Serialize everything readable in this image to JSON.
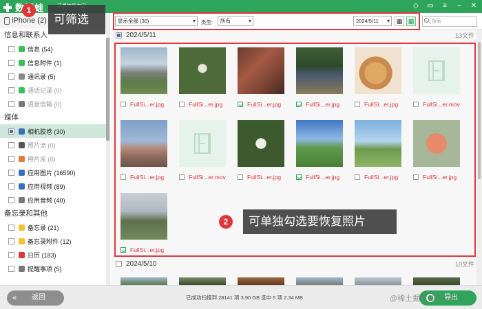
{
  "titlebar": {
    "app_name": "数据蛙",
    "subtitle": "苹果恢复专家"
  },
  "sidebar": {
    "device": "iPhone (2)",
    "sections": [
      {
        "title": "信息和联系人",
        "items": [
          {
            "label": "信息 (54)",
            "color": "#3cbf5a",
            "dim": false
          },
          {
            "label": "信息附件 (1)",
            "color": "#3cbf5a",
            "dim": false
          },
          {
            "label": "通讯录 (5)",
            "color": "#8a8a8a",
            "dim": false
          },
          {
            "label": "通话记录 (0)",
            "color": "#3cbf5a",
            "dim": true
          },
          {
            "label": "语音信箱 (0)",
            "color": "#777777",
            "dim": true
          }
        ]
      },
      {
        "title": "媒体",
        "items": [
          {
            "label": "相机胶卷 (30)",
            "color": "#3b6fb5",
            "dim": false,
            "active": true
          },
          {
            "label": "照片流 (0)",
            "color": "#555555",
            "dim": true
          },
          {
            "label": "照片库 (0)",
            "color": "#e07b39",
            "dim": true
          },
          {
            "label": "应用图片 (16590)",
            "color": "#3b6fb5",
            "dim": false
          },
          {
            "label": "应用视频 (89)",
            "color": "#3b6fb5",
            "dim": false
          },
          {
            "label": "应用音频 (40)",
            "color": "#777777",
            "dim": false
          }
        ]
      },
      {
        "title": "备忘录和其他",
        "items": [
          {
            "label": "备忘录 (21)",
            "color": "#f2c230",
            "dim": false
          },
          {
            "label": "备忘录附件 (12)",
            "color": "#f2c230",
            "dim": false
          },
          {
            "label": "日历 (183)",
            "color": "#e0373b",
            "dim": false
          },
          {
            "label": "提醒事项 (5)",
            "color": "#777777",
            "dim": false
          }
        ]
      }
    ]
  },
  "toolbar": {
    "filter_select": "显示全部 (30)",
    "type_label": "类型:",
    "type_select": "所有",
    "date_select": "2024/5/11",
    "search_placeholder": "搜索"
  },
  "groups": [
    {
      "date": "2024/5/11",
      "count": "13文件"
    },
    {
      "date": "2024/5/10",
      "count": "10文件"
    }
  ],
  "files": [
    {
      "name": "FullSi...er.jpg",
      "checked": false,
      "kind": "photo",
      "bg": "linear-gradient(180deg,#9fb6cc 0%,#c7d3de 35%,#7a7f78 55%,#5d7a48 75%,#6e8d52 100%)"
    },
    {
      "name": "FullSi...er.jpg",
      "checked": false,
      "kind": "photo",
      "bg": "radial-gradient(circle at 50% 45%,#e8e6d8 0 12%,#4d6b3a 14% 100%)"
    },
    {
      "name": "FullSi...er.jpg",
      "checked": true,
      "kind": "photo",
      "bg": "linear-gradient(135deg,#6b3b2f 0%,#a35a44 40%,#7c4333 70%,#3f2a22 100%)"
    },
    {
      "name": "FullSi...er.jpg",
      "checked": true,
      "kind": "photo",
      "bg": "linear-gradient(180deg,#3e5f36 0%,#2f4a2a 40%,#4a5a6e 60%,#8a7a5a 100%)"
    },
    {
      "name": "FullSi...er.jpg",
      "checked": false,
      "kind": "photo",
      "bg": "radial-gradient(circle at 45% 55%,#e0a865 0 30%,#c98a4b 31% 45%,#efe2cf 46% 100%)"
    },
    {
      "name": "FullSi...er.mov",
      "checked": false,
      "kind": "video",
      "bg": ""
    },
    {
      "name": "FullSi...er.jpg",
      "checked": false,
      "kind": "photo",
      "bg": "linear-gradient(180deg,#7ea0c8 0%,#9fb8d6 45%,#b78a7a 60%,#8c6b5c 78%,#6e5649 100%)"
    },
    {
      "name": "FullSi...er.mov",
      "checked": false,
      "kind": "video",
      "bg": ""
    },
    {
      "name": "FullSi...er.jpg",
      "checked": false,
      "kind": "photo",
      "bg": "radial-gradient(circle at 50% 50%,#efefe8 0 15%,#3d5a2e 17% 100%)"
    },
    {
      "name": "FullSi...er.jpg",
      "checked": true,
      "kind": "photo",
      "bg": "linear-gradient(180deg,#3f79c4 0%,#8fb7e6 40%,#5f9a4a 60%,#4b7e36 100%)"
    },
    {
      "name": "FullSi...er.jpg",
      "checked": false,
      "kind": "photo",
      "bg": "linear-gradient(180deg,#7fb0e0 0%,#b5d3ef 45%,#6e9a4e 62%,#8fb565 100%)"
    },
    {
      "name": "FullSi...er.jpg",
      "checked": false,
      "kind": "photo",
      "bg": "radial-gradient(circle at 50% 50%,#e88a6a 0 30%,#a7b89a 32% 100%)"
    },
    {
      "name": "FullSi...er.jpg",
      "checked": true,
      "kind": "photo",
      "bg": "linear-gradient(180deg,#c9d0d6 0%,#aeb8bf 40%,#5e6f4d 60%,#748a5c 100%)"
    }
  ],
  "next_row_bgs": [
    "linear-gradient(180deg,#9fb6cc,#5d7a48)",
    "linear-gradient(180deg,#7e8a6a,#3d4a2e)",
    "linear-gradient(180deg,#a0693e,#5a3b26)",
    "linear-gradient(180deg,#9fb6cc,#7a7f78)",
    "linear-gradient(180deg,#c0c6cf,#8d959e)",
    "linear-gradient(180deg,#5b6a4c,#3b4a2c)"
  ],
  "callouts": {
    "one_number": "1",
    "one_text": "可筛选",
    "two_number": "2",
    "two_text": "可单独勾选要恢复照片"
  },
  "bottom": {
    "back_label": "返回",
    "status_text": "已成功扫描到 28141 项 3.90 GB  选中 5 项 2.34 MB",
    "export_label": "导出"
  },
  "watermark": "@稀土掘金技术社区",
  "colors": {
    "brand_green": "#2fa55b",
    "annotation_red": "#e0373b",
    "callout_bg": "#3c3c3c"
  }
}
